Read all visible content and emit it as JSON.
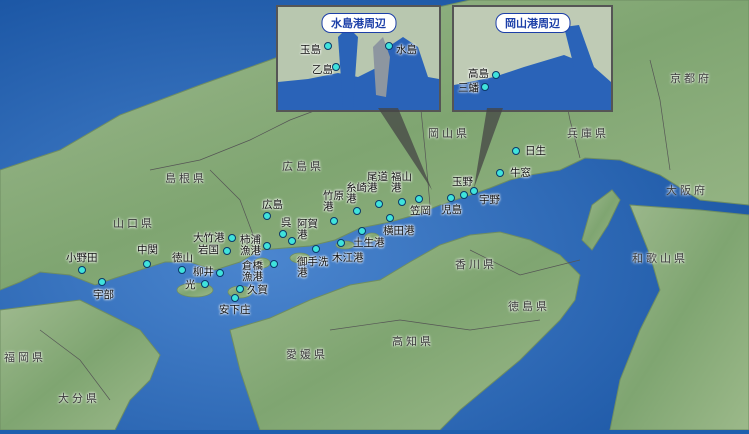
{
  "insets": {
    "mizushima": {
      "title": "水島港周辺",
      "ports": [
        "玉島",
        "水島",
        "乙島"
      ]
    },
    "okayama": {
      "title": "岡山港周辺",
      "ports": [
        "高島",
        "三蟠"
      ]
    }
  },
  "prefectures": [
    "島根県",
    "広島県",
    "岡山県",
    "兵庫県",
    "京都府",
    "大阪府",
    "山口県",
    "香川県",
    "和歌山県",
    "徳島県",
    "高知県",
    "愛媛県",
    "福岡県",
    "大分県"
  ],
  "ports": [
    "小野田",
    "宇部",
    "中関",
    "徳山",
    "光",
    "柳井",
    "岩国",
    "大竹港",
    "柿浦漁港",
    "倉橋漁港",
    "久賀",
    "安下庄",
    "広島",
    "呉",
    "阿賀港",
    "竹原港",
    "御手洗港",
    "木江港",
    "土生港",
    "糸崎港",
    "尾道港",
    "福山港",
    "横田港",
    "笠岡",
    "児島",
    "玉野",
    "宇野",
    "牛窓",
    "日生"
  ],
  "colors": {
    "sea": "#1d5fae",
    "land": "#8fb07f",
    "marker": "#3fe3dc",
    "inset_border": "#1c3fa8"
  }
}
